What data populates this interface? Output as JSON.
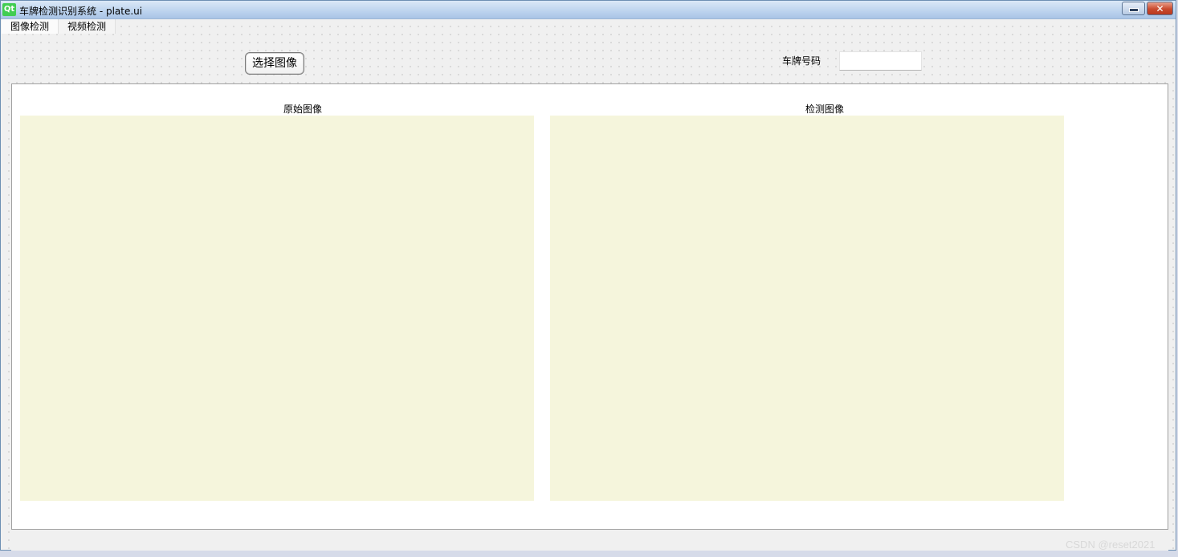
{
  "window": {
    "title": "车牌检测识别系统 - plate.ui",
    "icon_label": "Qt"
  },
  "tabs": [
    {
      "label": "图像检测",
      "active": true
    },
    {
      "label": "视频检测",
      "active": false
    }
  ],
  "toolbar": {
    "select_image_label": "选择图像",
    "plate_number_label": "车牌号码",
    "plate_number_value": ""
  },
  "panel": {
    "original_caption": "原始图像",
    "detected_caption": "检测图像"
  },
  "watermark": "CSDN @reset2021",
  "colors": {
    "image_placeholder": "#f5f5dc",
    "qt_green": "#41cd52"
  }
}
